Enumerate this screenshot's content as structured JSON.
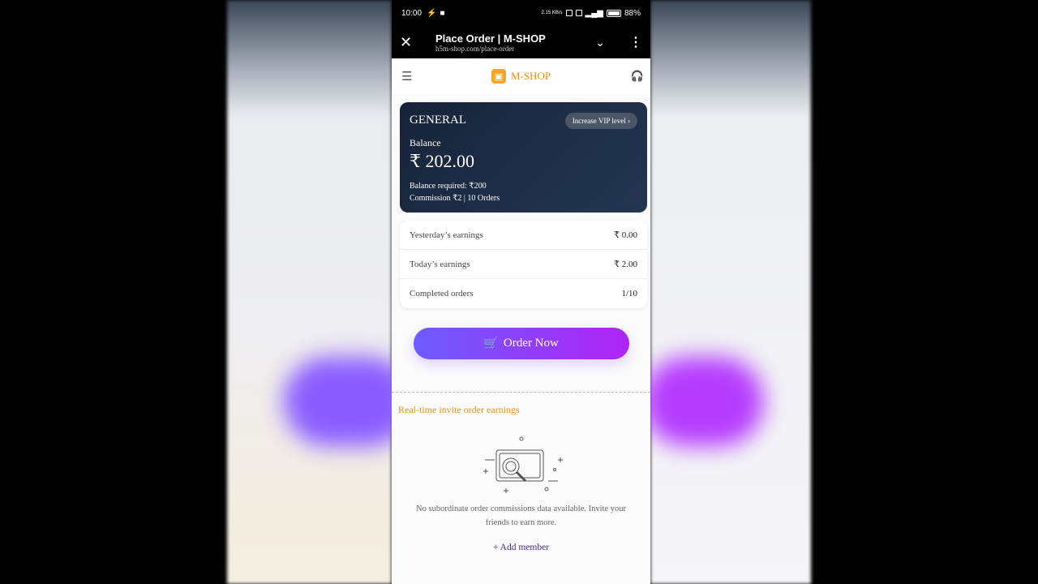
{
  "status": {
    "time": "10:00",
    "speed": "2.15 KB/s",
    "battery": "88%"
  },
  "browser": {
    "title": "Place Order | M-SHOP",
    "url": "h5m-shop.com/place-order"
  },
  "app": {
    "name": "M-SHOP"
  },
  "card": {
    "level": "GENERAL",
    "vip_button": "Increase VIP level",
    "balance_label": "Balance",
    "balance": "₹ 202.00",
    "balance_required": "Balance required: ₹200",
    "commission": "Commission ₹2 | 10 Orders"
  },
  "stats": [
    {
      "label": "Yesterday’s earnings",
      "value": "₹ 0.00"
    },
    {
      "label": "Today’s earnings",
      "value": "₹ 2.00"
    },
    {
      "label": "Completed orders",
      "value": "1/10"
    }
  ],
  "order_button": "Order Now",
  "invite": {
    "title": "Real-time invite order earnings",
    "empty_text": "No subordinate order commissions data available. Invite your friends to earn more.",
    "add_member": "+ Add member"
  },
  "colors": {
    "accent": "#f08c00",
    "button_start": "#6d5cff",
    "button_end": "#b024f5",
    "card": "#1b2a42"
  }
}
